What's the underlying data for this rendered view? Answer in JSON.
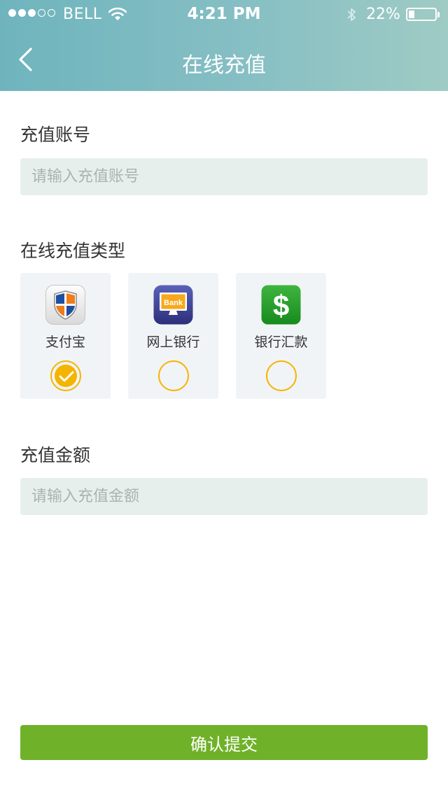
{
  "status_bar": {
    "carrier": "BELL",
    "signal_bars_filled": 3,
    "signal_bars_total": 5,
    "time": "4:21 PM",
    "battery_percent": "22%",
    "battery_level": 0.22
  },
  "nav": {
    "back_icon": "chevron-left-icon",
    "title": "在线充值"
  },
  "account": {
    "label": "充值账号",
    "placeholder": "请输入充值账号",
    "value": ""
  },
  "payment_type": {
    "label": "在线充值类型",
    "options": [
      {
        "label": "支付宝",
        "icon": "alipay-shield-icon",
        "selected": true
      },
      {
        "label": "网上银行",
        "icon": "bank-monitor-icon",
        "selected": false,
        "icon_text": "Bank"
      },
      {
        "label": "银行汇款",
        "icon": "dollar-sign-icon",
        "selected": false,
        "icon_text": "$"
      }
    ]
  },
  "amount": {
    "label": "充值金额",
    "placeholder": "请输入充值金额",
    "value": ""
  },
  "submit_label": "确认提交",
  "colors": {
    "header_start": "#6fb4bd",
    "header_end": "#9fcbc4",
    "accent_yellow": "#f5b400",
    "submit_green": "#6fb229",
    "input_bg": "#e7efed"
  }
}
